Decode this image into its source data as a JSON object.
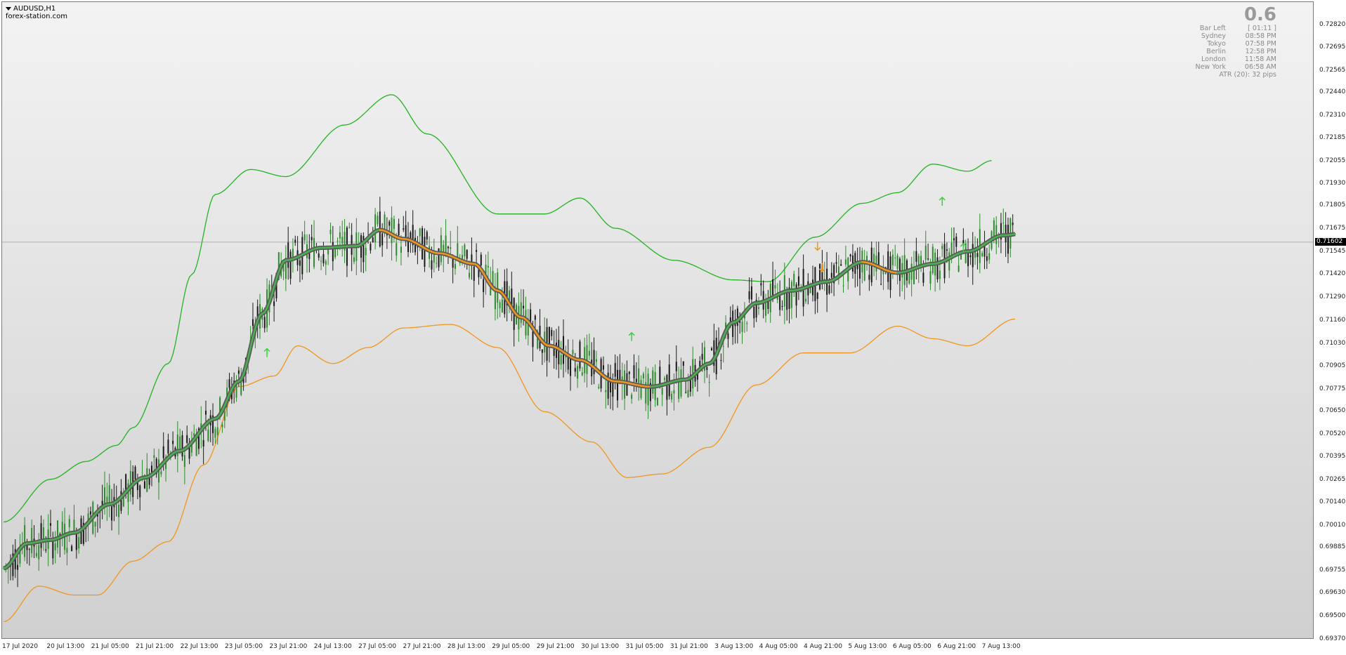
{
  "window": {
    "symbol": "AUDUSD,H1",
    "watermark": "forex-station.com"
  },
  "info_panel": {
    "big_value": "0.6",
    "rows": [
      {
        "label": "Bar Left",
        "value": "[ 01:11 ]"
      },
      {
        "label": "Sydney",
        "value": "08:58 PM"
      },
      {
        "label": "Tokyo",
        "value": "07:58 PM"
      },
      {
        "label": "Berlin",
        "value": "12:58 PM"
      },
      {
        "label": "London",
        "value": "11:58 AM"
      },
      {
        "label": "New York",
        "value": "06:58 AM"
      }
    ],
    "atr_text": "ATR (20): 32 pips"
  },
  "price_axis": {
    "labels": [
      "0.72820",
      "0.72695",
      "0.72565",
      "0.72440",
      "0.72310",
      "0.72185",
      "0.72055",
      "0.71930",
      "0.71805",
      "0.71675",
      "0.71545",
      "0.71420",
      "0.71290",
      "0.71160",
      "0.71030",
      "0.70905",
      "0.70775",
      "0.70650",
      "0.70520",
      "0.70395",
      "0.70265",
      "0.70140",
      "0.70010",
      "0.69885",
      "0.69755",
      "0.69630",
      "0.69500",
      "0.69370"
    ],
    "current_price": "0.71602"
  },
  "time_axis": {
    "labels": [
      "17 Jul 2020",
      "20 Jul 13:00",
      "21 Jul 05:00",
      "21 Jul 21:00",
      "22 Jul 13:00",
      "23 Jul 05:00",
      "23 Jul 21:00",
      "24 Jul 13:00",
      "27 Jul 05:00",
      "27 Jul 21:00",
      "28 Jul 13:00",
      "29 Jul 05:00",
      "29 Jul 21:00",
      "30 Jul 13:00",
      "31 Jul 05:00",
      "31 Jul 21:00",
      "3 Aug 13:00",
      "4 Aug 05:00",
      "4 Aug 21:00",
      "5 Aug 13:00",
      "6 Aug 05:00",
      "6 Aug 21:00",
      "7 Aug 13:00"
    ]
  },
  "colors": {
    "bull_candle": "#2e8b2e",
    "bear_candle": "#1a1a1a",
    "upper_band": "#23b323",
    "lower_band": "#f0961e",
    "mid_line_outer": "#5a5a5a",
    "mid_line_up": "#4caf50",
    "mid_line_down": "#f0961e",
    "buy_arrow": "#3ccf3c",
    "sell_arrow": "#f0961e",
    "price_line": "#b0b0b0"
  },
  "chart_data": {
    "type": "candlestick",
    "ylim": [
      0.6937,
      0.7295
    ],
    "bar_count": 430,
    "midline": [
      [
        0,
        0.6977
      ],
      [
        10,
        0.6991
      ],
      [
        20,
        0.6993
      ],
      [
        30,
        0.6997
      ],
      [
        45,
        0.7013
      ],
      [
        60,
        0.7028
      ],
      [
        75,
        0.7043
      ],
      [
        90,
        0.7061
      ],
      [
        100,
        0.7082
      ],
      [
        110,
        0.712
      ],
      [
        120,
        0.715
      ],
      [
        135,
        0.7157
      ],
      [
        150,
        0.7158
      ],
      [
        160,
        0.7167
      ],
      [
        170,
        0.7162
      ],
      [
        185,
        0.7154
      ],
      [
        200,
        0.7148
      ],
      [
        210,
        0.7133
      ],
      [
        220,
        0.7118
      ],
      [
        232,
        0.7102
      ],
      [
        245,
        0.7094
      ],
      [
        260,
        0.7082
      ],
      [
        275,
        0.7079
      ],
      [
        290,
        0.7083
      ],
      [
        300,
        0.7092
      ],
      [
        310,
        0.7115
      ],
      [
        320,
        0.7126
      ],
      [
        335,
        0.7133
      ],
      [
        350,
        0.7138
      ],
      [
        365,
        0.7149
      ],
      [
        380,
        0.7143
      ],
      [
        395,
        0.7148
      ],
      [
        410,
        0.7155
      ],
      [
        425,
        0.7164
      ],
      [
        440,
        0.7167
      ]
    ],
    "upper_band": [
      [
        0,
        0.7003
      ],
      [
        20,
        0.7027
      ],
      [
        35,
        0.7037
      ],
      [
        48,
        0.7046
      ],
      [
        55,
        0.7056
      ],
      [
        70,
        0.7092
      ],
      [
        80,
        0.7142
      ],
      [
        90,
        0.7187
      ],
      [
        105,
        0.7201
      ],
      [
        120,
        0.7197
      ],
      [
        145,
        0.7226
      ],
      [
        165,
        0.7243
      ],
      [
        180,
        0.7221
      ],
      [
        210,
        0.7176
      ],
      [
        230,
        0.7176
      ],
      [
        245,
        0.7185
      ],
      [
        260,
        0.7168
      ],
      [
        285,
        0.715
      ],
      [
        310,
        0.7139
      ],
      [
        325,
        0.7138
      ],
      [
        345,
        0.7163
      ],
      [
        365,
        0.7182
      ],
      [
        380,
        0.7188
      ],
      [
        395,
        0.7204
      ],
      [
        410,
        0.72
      ],
      [
        420,
        0.7206
      ]
    ],
    "lower_band": [
      [
        0,
        0.6947
      ],
      [
        15,
        0.6967
      ],
      [
        30,
        0.6962
      ],
      [
        40,
        0.6962
      ],
      [
        55,
        0.6981
      ],
      [
        70,
        0.6992
      ],
      [
        85,
        0.7035
      ],
      [
        100,
        0.7079
      ],
      [
        115,
        0.7085
      ],
      [
        125,
        0.7102
      ],
      [
        140,
        0.7092
      ],
      [
        155,
        0.7101
      ],
      [
        170,
        0.7112
      ],
      [
        190,
        0.7114
      ],
      [
        210,
        0.7101
      ],
      [
        230,
        0.7065
      ],
      [
        250,
        0.7048
      ],
      [
        265,
        0.7028
      ],
      [
        280,
        0.703
      ],
      [
        300,
        0.7045
      ],
      [
        320,
        0.708
      ],
      [
        340,
        0.7098
      ],
      [
        360,
        0.7098
      ],
      [
        380,
        0.7113
      ],
      [
        395,
        0.7106
      ],
      [
        410,
        0.7102
      ],
      [
        430,
        0.7117
      ]
    ]
  }
}
